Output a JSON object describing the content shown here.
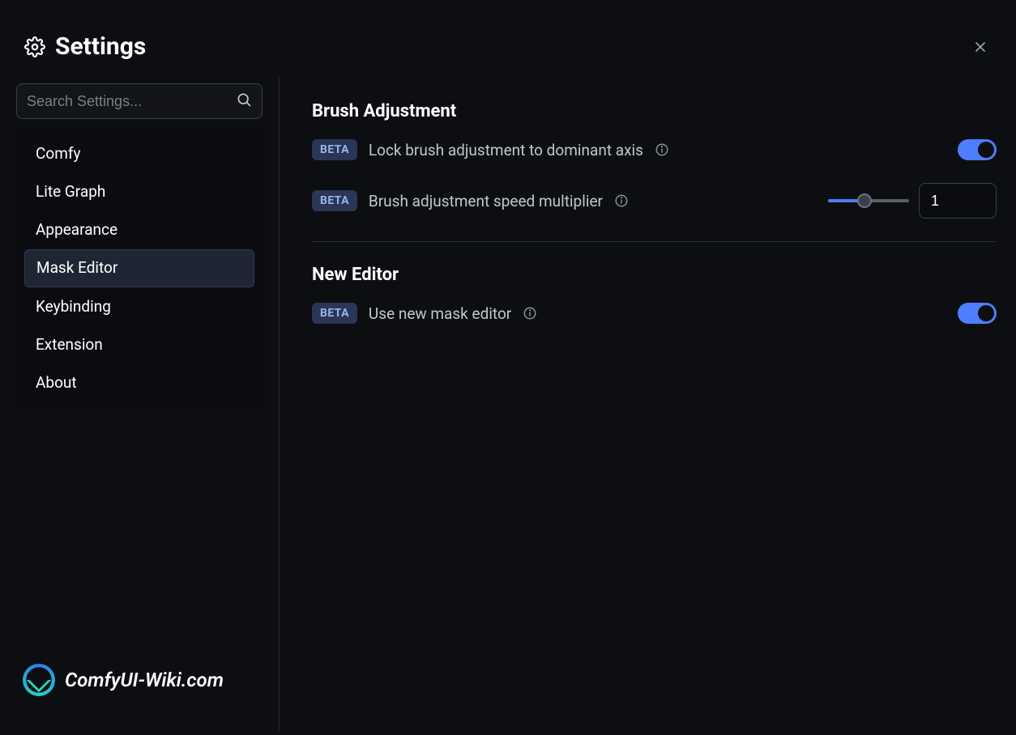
{
  "header": {
    "title": "Settings"
  },
  "search": {
    "placeholder": "Search Settings...",
    "value": ""
  },
  "sidebar": {
    "items": [
      {
        "label": "Comfy",
        "active": false
      },
      {
        "label": "Lite Graph",
        "active": false
      },
      {
        "label": "Appearance",
        "active": false
      },
      {
        "label": "Mask Editor",
        "active": true
      },
      {
        "label": "Keybinding",
        "active": false
      },
      {
        "label": "Extension",
        "active": false
      },
      {
        "label": "About",
        "active": false
      }
    ]
  },
  "badges": {
    "beta": "BETA"
  },
  "sections": {
    "brush": {
      "title": "Brush Adjustment",
      "lock_label": "Lock brush adjustment to dominant axis",
      "lock_on": true,
      "speed_label": "Brush adjustment speed multiplier",
      "speed_value": "1"
    },
    "new_editor": {
      "title": "New Editor",
      "use_new_label": "Use new mask editor",
      "use_new_on": true
    }
  },
  "watermark": {
    "text": "ComfyUI-Wiki.com"
  },
  "colors": {
    "accent": "#4e7dff",
    "badge_bg": "#2a3655",
    "badge_fg": "#97b4f0"
  }
}
